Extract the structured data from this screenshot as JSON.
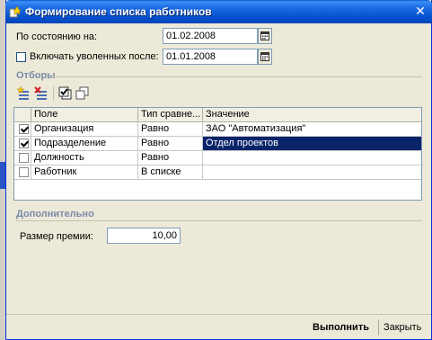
{
  "window": {
    "title": "Формирование списка работников",
    "close_glyph": "✕"
  },
  "state": {
    "as_of_label": "По состоянию на:",
    "as_of_value": "01.02.2008",
    "include_fired_label": "Включать уволенных после:",
    "include_fired_value": "01.01.2008",
    "include_fired_checked": false
  },
  "filters": {
    "title": "Отборы",
    "toolbar_icons": [
      "add-filter-icon",
      "delete-filter-icon",
      "check-all-icon",
      "copy-icon"
    ],
    "columns": [
      "Поле",
      "Тип сравне...",
      "Значение"
    ],
    "rows": [
      {
        "checked": true,
        "field": "Организация",
        "comparison": "Равно",
        "value": "ЗАО \"Автоматизация\"",
        "selected": false
      },
      {
        "checked": true,
        "field": "Подразделение",
        "comparison": "Равно",
        "value": "Отдел проектов",
        "selected": true
      },
      {
        "checked": false,
        "field": "Должность",
        "comparison": "Равно",
        "value": "",
        "selected": false
      },
      {
        "checked": false,
        "field": "Работник",
        "comparison": "В списке",
        "value": "",
        "selected": false
      }
    ]
  },
  "extra": {
    "title": "Дополнительно",
    "bonus_label": "Размер премии:",
    "bonus_value": "10,00"
  },
  "footer": {
    "run_label": "Выполнить",
    "close_label": "Закрыть"
  },
  "colors": {
    "titlebar": "#0653d1",
    "selection": "#0a246a",
    "dialog_bg": "#ece9d8",
    "section_title": "#7a8aa8"
  }
}
